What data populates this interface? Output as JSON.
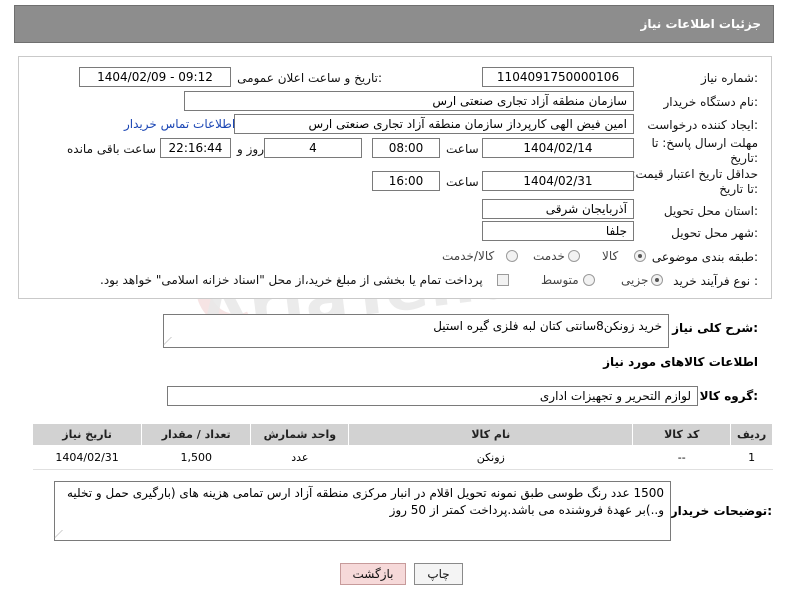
{
  "header": {
    "title": "جزئیات اطلاعات نیاز"
  },
  "watermark": {
    "text": "AriaTender.neT"
  },
  "form": {
    "need_number_label": "شماره نیاز:",
    "need_number": "1104091750000106",
    "announce_label": "تاریخ و ساعت اعلان عمومی:",
    "announce_value": "1404/02/09 - 09:12",
    "buyer_org_label": "نام دستگاه خریدار:",
    "buyer_org": "سازمان منطقه آزاد تجاری صنعتی ارس",
    "requester_label": "ایجاد کننده درخواست:",
    "requester": "امین فیض الهی کارپرداز سازمان منطقه آزاد تجاری صنعتی ارس",
    "contact_link": "اطلاعات تماس خریدار",
    "deadline_label": "مهلت ارسال پاسخ: تا تاریخ:",
    "deadline_date": "1404/02/14",
    "time_word": "ساعت",
    "deadline_time": "08:00",
    "days_value": "4",
    "days_word": "روز و",
    "remaining_time": "22:16:44",
    "remaining_word": "ساعت باقی مانده",
    "validity_label": "حداقل تاریخ اعتبار قیمت: تا تاریخ:",
    "validity_date": "1404/02/31",
    "validity_time": "16:00",
    "province_label": "استان محل تحویل:",
    "province": "آذربایجان شرقی",
    "city_label": "شهر محل تحویل:",
    "city": "جلفا",
    "category_label": "طبقه بندی موضوعی:",
    "category_options": [
      "کالا",
      "خدمت",
      "کالا/خدمت"
    ],
    "process_label": "نوع فرآیند خرید :",
    "process_options": [
      "جزیی",
      "متوسط"
    ],
    "payment_note": "پرداخت تمام یا بخشی از مبلغ خرید،از محل \"اسناد خزانه اسلامی\" خواهد بود."
  },
  "description": {
    "label": "شرح کلی نیاز:",
    "text": "خرید زونکن8سانتی کتان لبه فلزی گیره استیل"
  },
  "goods_info": {
    "heading": "اطلاعات کالاهای مورد نیاز",
    "group_label": "گروه کالا:",
    "group_value": "لوازم التحریر و تجهیزات اداری"
  },
  "table": {
    "headers": [
      "ردیف",
      "کد کالا",
      "نام کالا",
      "واحد شمارش",
      "تعداد / مقدار",
      "تاریخ نیاز"
    ],
    "rows": [
      {
        "row": "1",
        "code": "--",
        "name": "زونکن",
        "unit": "عدد",
        "qty": "1,500",
        "date": "1404/02/31"
      }
    ]
  },
  "buyer_notes": {
    "label": "توضیحات خریدار:",
    "text": "1500 عدد رنگ طوسی طبق نمونه تحویل اقلام در انبار مرکزی منطقه آزاد ارس تمامی هزینه های (بارگیری حمل و تخلیه و..)بر عهدهٔ فروشنده می باشد.پرداخت کمتر از 50 روز"
  },
  "buttons": {
    "print": "چاپ",
    "back": "بازگشت"
  }
}
